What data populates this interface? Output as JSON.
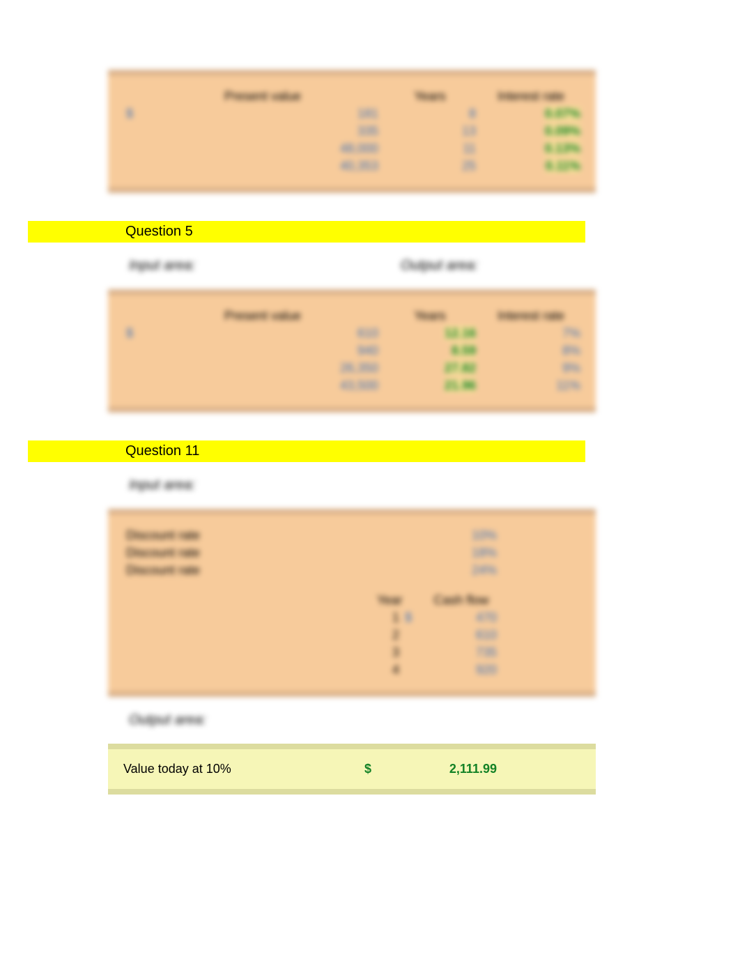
{
  "table1": {
    "headers": {
      "pv": "Present value",
      "years": "Years",
      "rate": "Interest rate"
    },
    "dollar": "$",
    "rows": [
      {
        "pv": "181",
        "years": "8",
        "rate": "0.07%"
      },
      {
        "pv": "335",
        "years": "13",
        "rate": "0.09%"
      },
      {
        "pv": "48,000",
        "years": "11",
        "rate": "0.13%"
      },
      {
        "pv": "40,353",
        "years": "25",
        "rate": "0.11%"
      }
    ]
  },
  "q5": {
    "title": "Question 5",
    "input_label": "Input area:",
    "output_label": "Output area:",
    "headers": {
      "pv": "Present value",
      "years": "Years",
      "rate": "Interest rate"
    },
    "dollar": "$",
    "rows": [
      {
        "pv": "610",
        "years": "12.16",
        "rate": "7%"
      },
      {
        "pv": "940",
        "years": "8.59",
        "rate": "8%"
      },
      {
        "pv": "26,350",
        "years": "27.82",
        "rate": "9%"
      },
      {
        "pv": "43,500",
        "years": "21.96",
        "rate": "11%"
      }
    ]
  },
  "q11": {
    "title": "Question 11",
    "input_label": "Input area:",
    "output_label": "Output area:",
    "dr_label": "Discount rate",
    "dr": [
      "10%",
      "18%",
      "24%"
    ],
    "cf_headers": {
      "year": "Year",
      "cf": "Cash flow"
    },
    "dollar": "$",
    "cf_rows": [
      {
        "year": "1",
        "cf": "470"
      },
      {
        "year": "2",
        "cf": "610"
      },
      {
        "year": "3",
        "cf": "735"
      },
      {
        "year": "4",
        "cf": "920"
      }
    ],
    "result": {
      "label": "Value today at 10%",
      "dollar": "$",
      "value": "2,111.99"
    }
  }
}
